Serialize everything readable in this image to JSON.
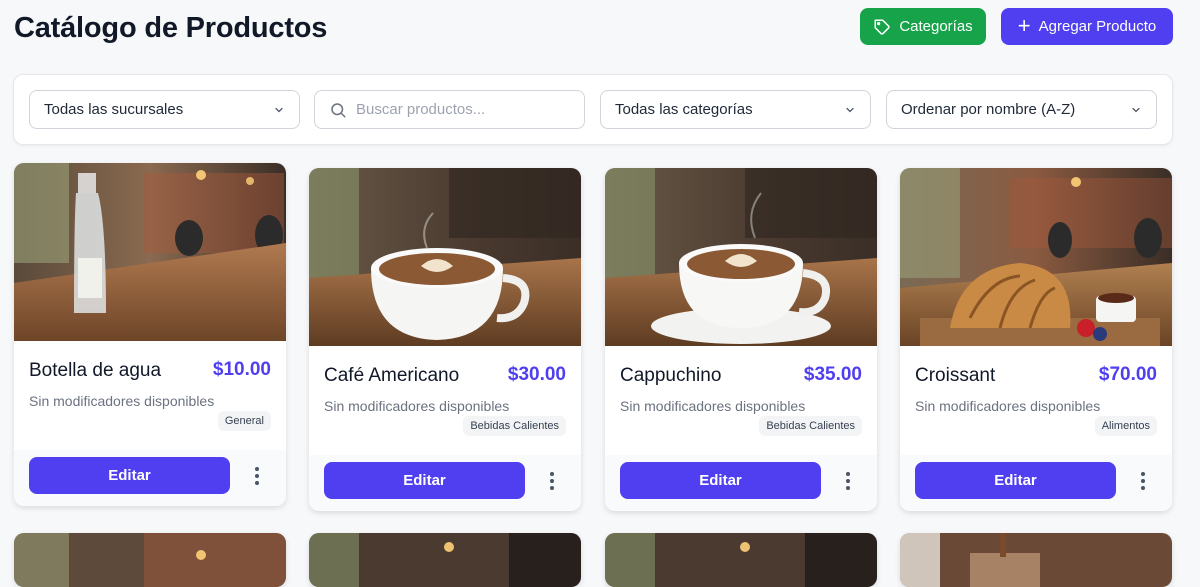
{
  "header": {
    "title": "Catálogo de Productos",
    "categories_button": "Categorías",
    "add_button": "Agregar Producto"
  },
  "filters": {
    "branch": "Todas las sucursales",
    "search_placeholder": "Buscar productos...",
    "category": "Todas las categorías",
    "sort": "Ordenar por nombre (A-Z)"
  },
  "products": [
    {
      "name": "Botella de agua",
      "price": "$10.00",
      "modifiers": "Sin modificadores disponibles",
      "category": "General",
      "edit_label": "Editar",
      "image": "water-bottle"
    },
    {
      "name": "Café Americano",
      "price": "$30.00",
      "modifiers": "Sin modificadores disponibles",
      "category": "Bebidas Calientes",
      "edit_label": "Editar",
      "image": "coffee-cup"
    },
    {
      "name": "Cappuchino",
      "price": "$35.00",
      "modifiers": "Sin modificadores disponibles",
      "category": "Bebidas Calientes",
      "edit_label": "Editar",
      "image": "cappuccino-cup"
    },
    {
      "name": "Croissant",
      "price": "$70.00",
      "modifiers": "Sin modificadores disponibles",
      "category": "Alimentos",
      "edit_label": "Editar",
      "image": "croissant"
    }
  ],
  "colors": {
    "primary": "#4f3ff0",
    "success": "#16a34a",
    "background": "#f7f8fa"
  }
}
